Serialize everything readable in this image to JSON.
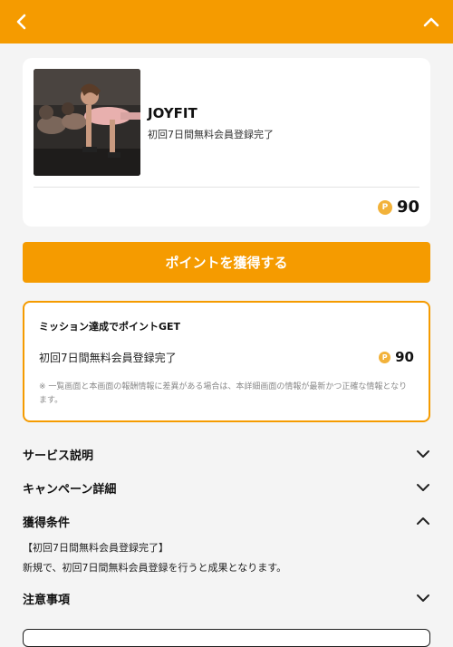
{
  "header": {
    "back_icon": "chevron-left-icon",
    "collapse_icon": "chevron-up-icon",
    "color": "#f59b00"
  },
  "offer": {
    "image": "workout-photo",
    "brand": "JOYFIT",
    "subtitle": "初回7日間無料会員登録完了",
    "coin_symbol": "P",
    "points": "90"
  },
  "cta": {
    "label": "ポイントを獲得する"
  },
  "mission": {
    "title": "ミッション達成でポイントGET",
    "row_label": "初回7日間無料会員登録完了",
    "coin_symbol": "P",
    "points": "90",
    "note": "※ 一覧画面と本画面の報酬情報に差異がある場合は、本詳細画面の情報が最新かつ正確な情報となります。"
  },
  "sections": [
    {
      "title": "サービス説明",
      "expanded": false
    },
    {
      "title": "キャンペーン詳細",
      "expanded": false
    },
    {
      "title": "獲得条件",
      "expanded": true,
      "body_line1": "【初回7日間無料会員登録完了】",
      "body_line2": "新規で、初回7日間無料会員登録を行うと成果となります。"
    },
    {
      "title": "注意事項",
      "expanded": false
    }
  ]
}
